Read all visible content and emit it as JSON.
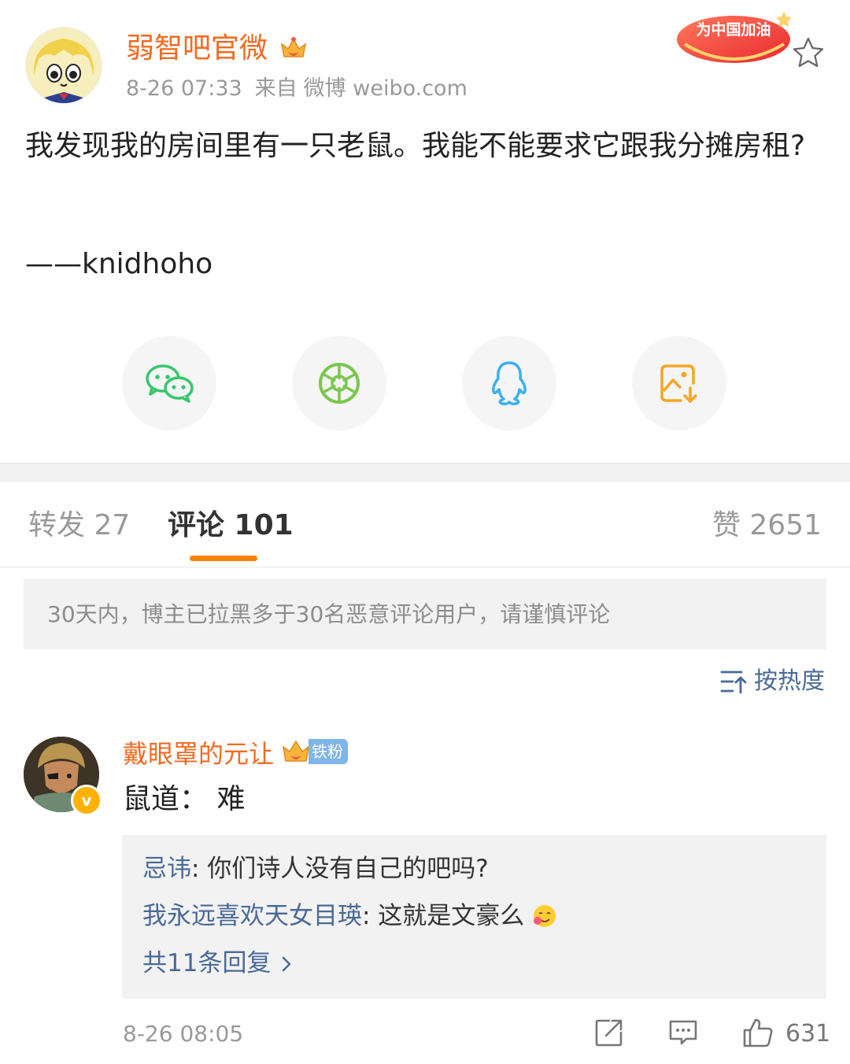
{
  "post": {
    "author_name": "弱智吧官微",
    "time": "8-26 07:33",
    "source_prefix": "来自",
    "source": "微博 weibo.com",
    "promo_badge_text": "为中国加油",
    "content": "我发现我的房间里有一只老鼠。我能不能要求它跟我分摊房租?",
    "signature": "——knidhoho"
  },
  "share": [
    {
      "icon": "wechat-icon",
      "color": "#36c76b"
    },
    {
      "icon": "moments-icon",
      "color": "#7ac74f"
    },
    {
      "icon": "qq-icon",
      "color": "#3bb0ee"
    },
    {
      "icon": "save-image-icon",
      "color": "#f5a623"
    }
  ],
  "tabs": {
    "repost": "转发 27",
    "comments": "评论 101",
    "likes": "赞 2651"
  },
  "notice": "30天内，博主已拉黑多于30名恶意评论用户，请谨慎评论",
  "sort": "按热度",
  "comment": {
    "user": "戴眼罩的元让",
    "fan_badge": "铁粉",
    "text": "鼠道：  难",
    "replies": [
      {
        "user": "忌讳",
        "text": ": 你们诗人没有自己的吧吗?"
      },
      {
        "user": "我永远喜欢天女目瑛",
        "text": ": 这就是文豪么"
      }
    ],
    "more_replies": "共11条回复 ",
    "time": "8-26 08:05",
    "like_count": "631"
  },
  "colors": {
    "accent": "#ff8200",
    "name": "#f36a20",
    "link": "#4a6a96"
  }
}
